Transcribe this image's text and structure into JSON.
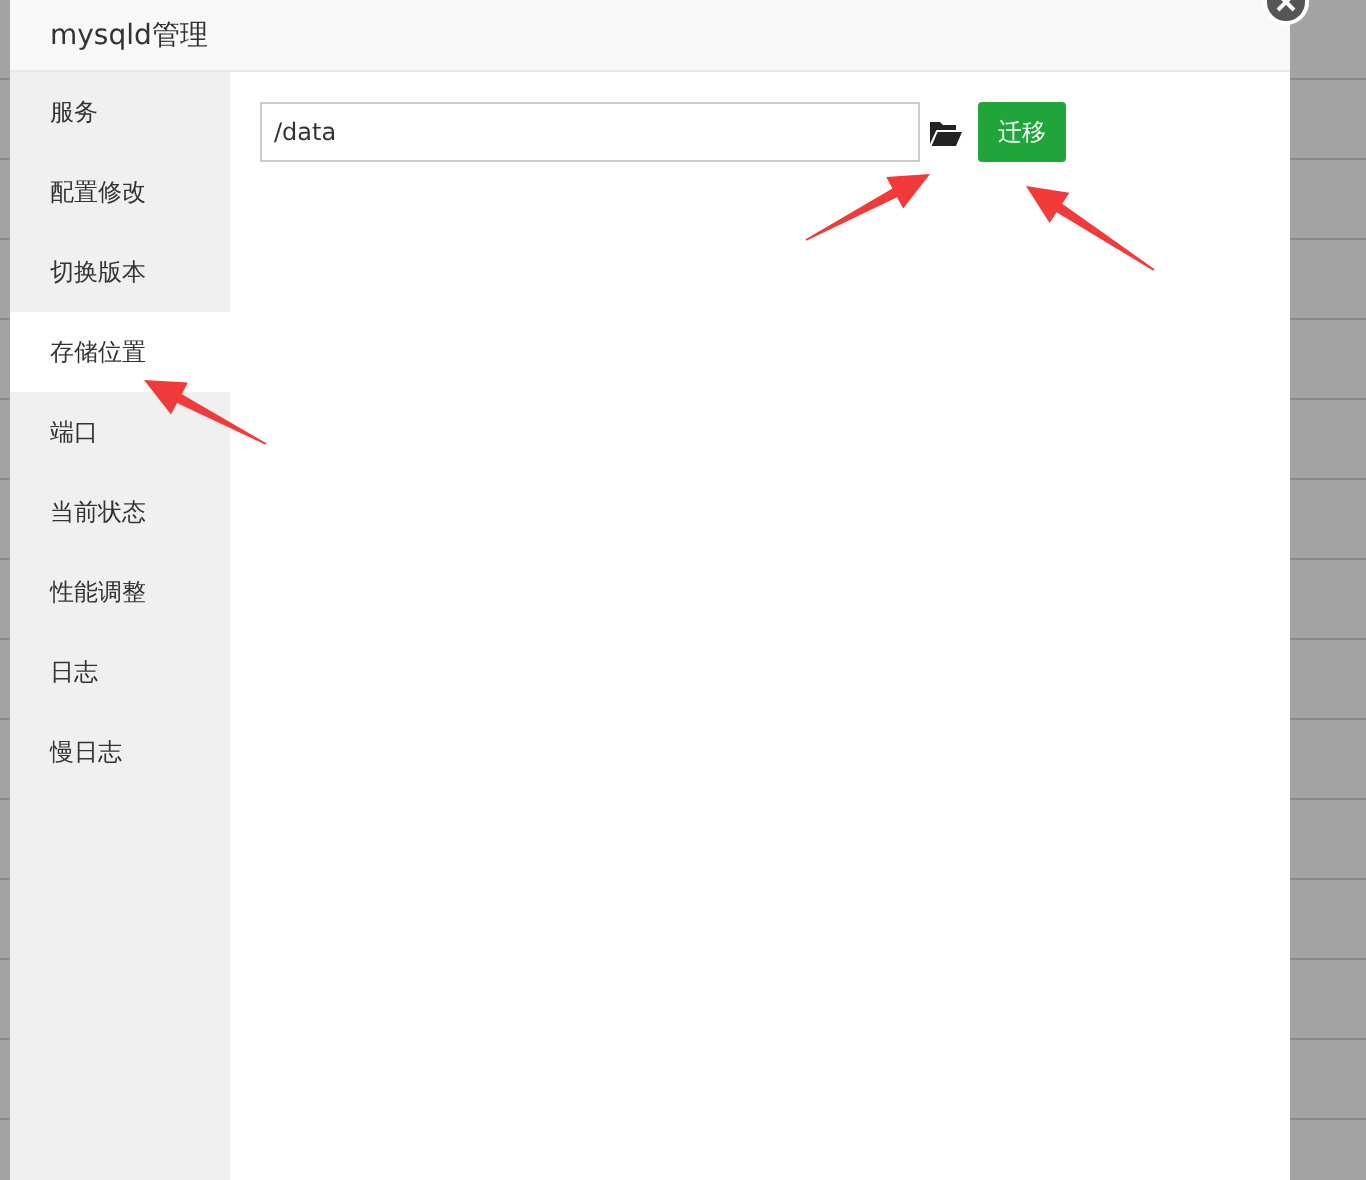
{
  "dialog": {
    "title": "mysqld管理",
    "menu": [
      {
        "label": "服务",
        "selected": false
      },
      {
        "label": "配置修改",
        "selected": false
      },
      {
        "label": "切换版本",
        "selected": false
      },
      {
        "label": "存储位置",
        "selected": true
      },
      {
        "label": "端口",
        "selected": false
      },
      {
        "label": "当前状态",
        "selected": false
      },
      {
        "label": "性能调整",
        "selected": false
      },
      {
        "label": "日志",
        "selected": false
      },
      {
        "label": "慢日志",
        "selected": false
      }
    ],
    "path_field": {
      "value": "/data"
    },
    "migrate_button": "迁移"
  }
}
